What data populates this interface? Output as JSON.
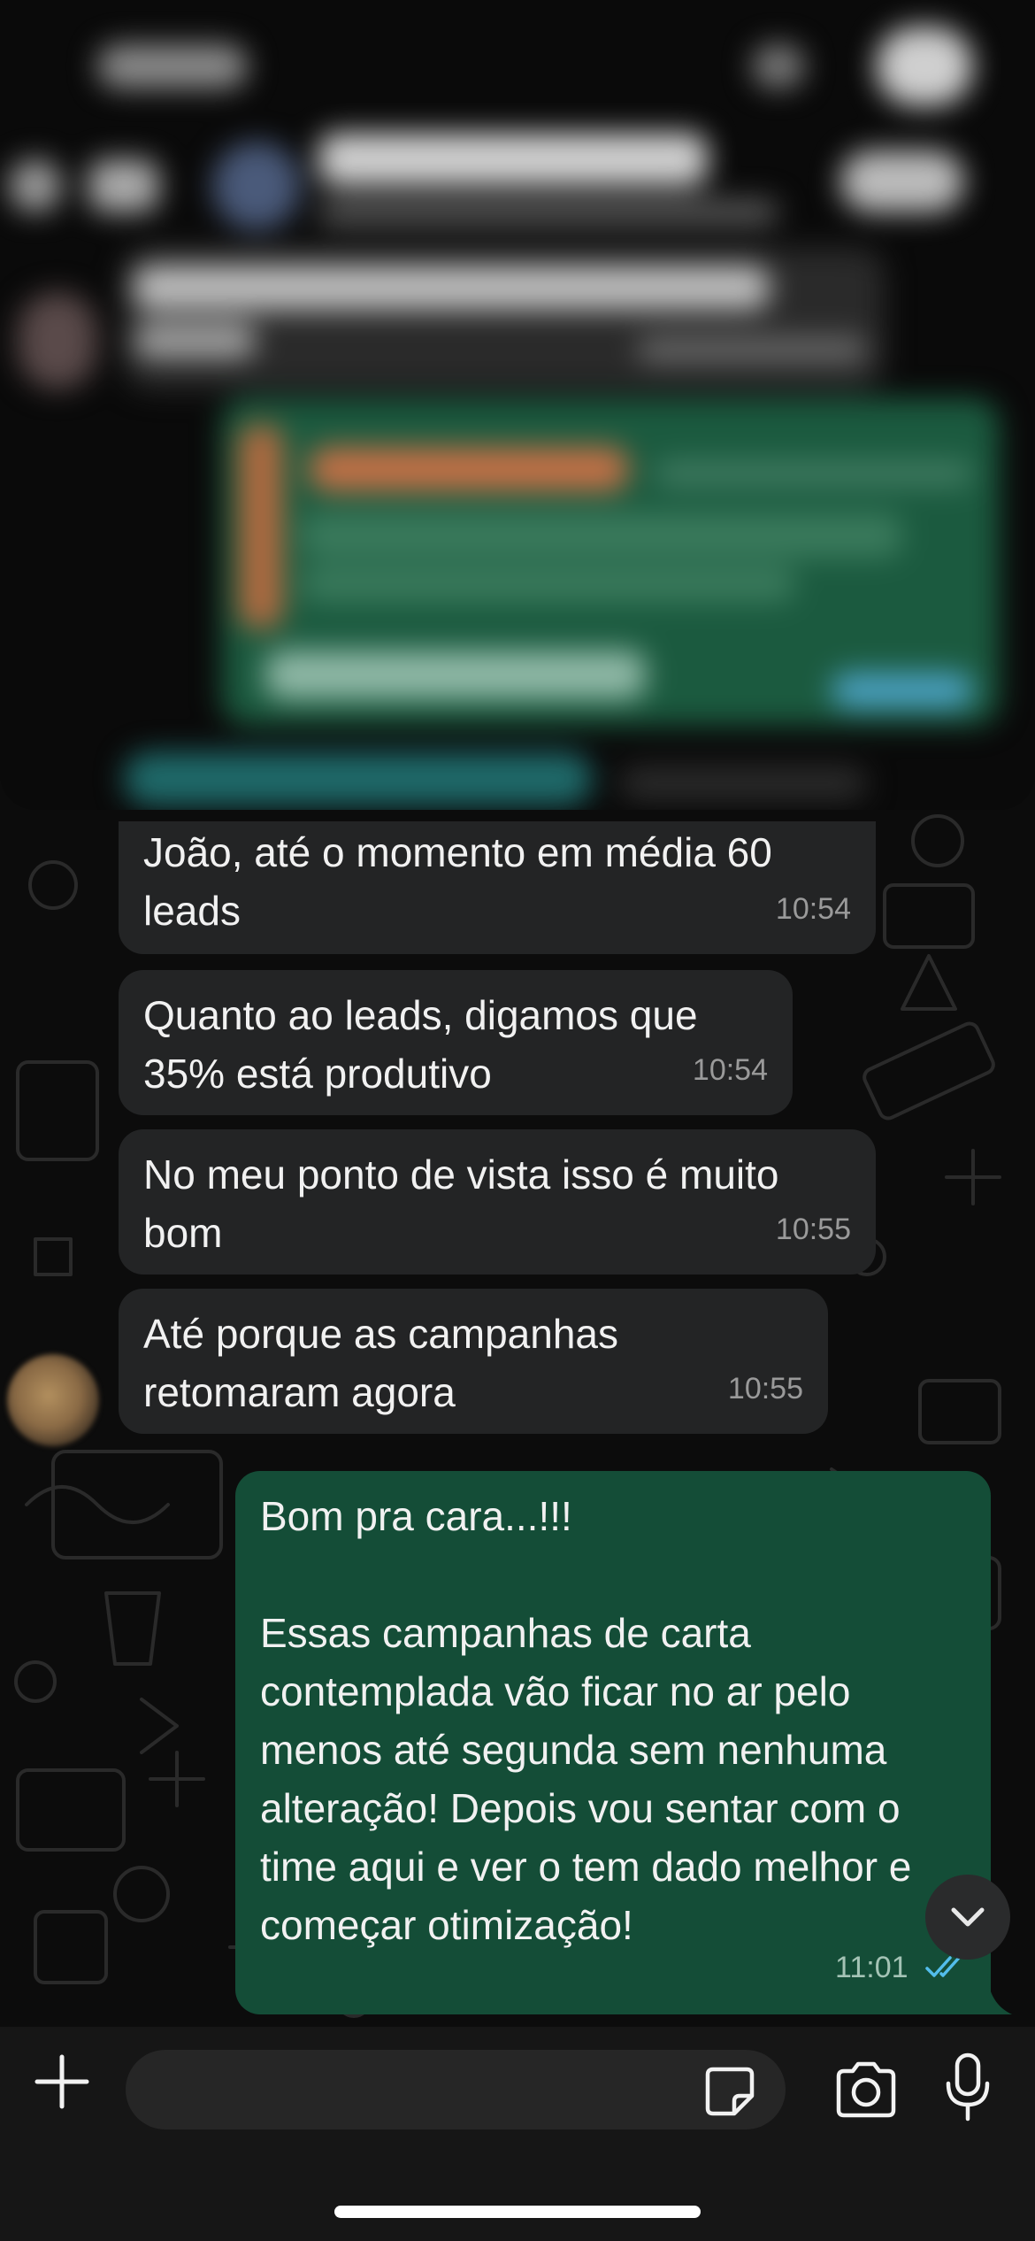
{
  "messages": [
    {
      "direction": "in",
      "text": "João, até o momento em média 60 leads",
      "time": "10:54"
    },
    {
      "direction": "in",
      "text": "Quanto ao leads, digamos que 35% está produtivo",
      "time": "10:54"
    },
    {
      "direction": "in",
      "text": "No meu ponto de vista isso é muito bom",
      "time": "10:55"
    },
    {
      "direction": "in",
      "text": "Até porque as campanhas retomaram agora",
      "time": "10:55"
    },
    {
      "direction": "out",
      "text": "Bom pra cara...!!!\n\nEssas campanhas de carta contemplada vão ficar no ar pelo menos até segunda sem nenhuma alteração! Depois vou sentar com o time aqui e ver o tem dado melhor e começar otimização!",
      "time": "11:01",
      "status": "read"
    }
  ],
  "composer": {
    "placeholder": "",
    "icons": [
      "plus-icon",
      "sticker-icon",
      "camera-icon",
      "microphone-icon"
    ]
  },
  "colors": {
    "incoming_bubble": "#232425",
    "outgoing_bubble": "#144d37",
    "read_ticks": "#53bdeb",
    "background": "#0c0c0c"
  }
}
